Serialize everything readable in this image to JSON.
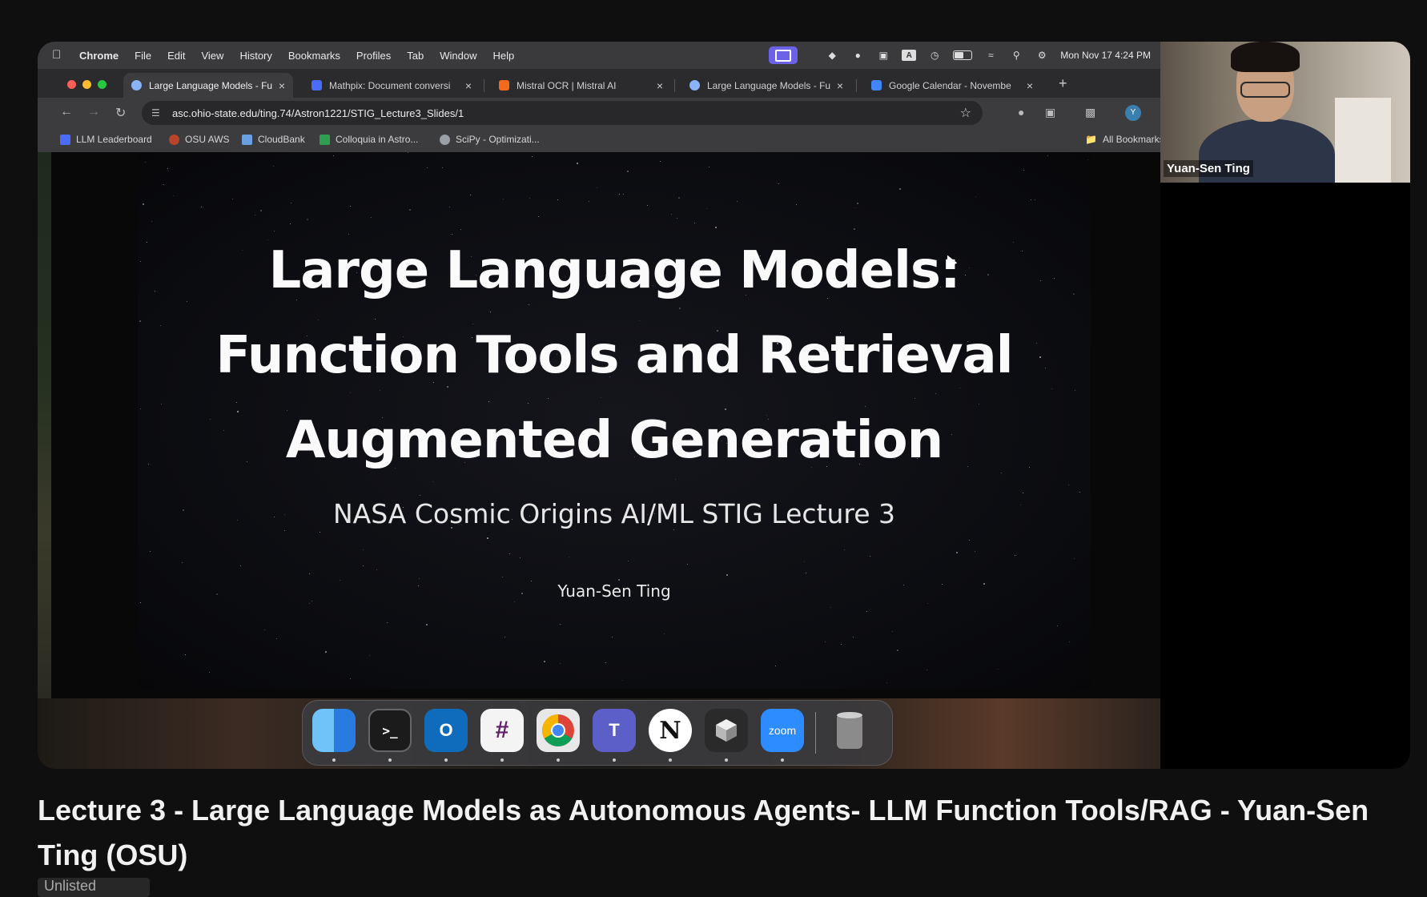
{
  "menubar": {
    "items": [
      "Chrome",
      "File",
      "Edit",
      "View",
      "History",
      "Bookmarks",
      "Profiles",
      "Tab",
      "Window",
      "Help"
    ],
    "datetime": "Mon Nov 17  4:24 PM"
  },
  "tabs": [
    {
      "title": "Large Language Models - Fu",
      "active": true,
      "favicon_color": "#8ab4f8"
    },
    {
      "title": "Mathpix: Document conversi",
      "active": false,
      "favicon_color": "#4a6cf7"
    },
    {
      "title": "Mistral OCR | Mistral AI",
      "active": false,
      "favicon_color": "#f26b1d"
    },
    {
      "title": "Large Language Models - Fu",
      "active": false,
      "favicon_color": "#8ab4f8"
    },
    {
      "title": "Google Calendar - Novembe",
      "active": false,
      "favicon_color": "#4285f4"
    }
  ],
  "omnibox": {
    "url": "asc.ohio-state.edu/ting.74/Astron1221/STIG_Lecture3_Slides/1"
  },
  "profile_initial": "Y",
  "bookmarks": [
    {
      "label": "LLM Leaderboard",
      "icon_color": "#4a6cf7"
    },
    {
      "label": "OSU AWS",
      "icon_color": "#b8442a"
    },
    {
      "label": "CloudBank",
      "icon_color": "#6aa0e0"
    },
    {
      "label": "Colloquia in Astro...",
      "icon_color": "#2f9e4f"
    },
    {
      "label": "SciPy - Optimizati...",
      "icon_color": "#9aa0a6"
    }
  ],
  "bookmarks_all": "All Bookmarks",
  "slide": {
    "title_lines": [
      "Large Language Models:",
      "Function Tools and Retrieval",
      "Augmented Generation"
    ],
    "subtitle": "NASA Cosmic Origins AI/ML STIG Lecture 3",
    "author": "Yuan-Sen Ting"
  },
  "dock": [
    {
      "name": "finder-icon",
      "label": "",
      "color": "#3a8ee6"
    },
    {
      "name": "terminal-icon",
      "label": ">_",
      "color": "#1b1b1b"
    },
    {
      "name": "outlook-icon",
      "label": "O",
      "color": "#0f6cbd"
    },
    {
      "name": "slack-icon",
      "label": "#",
      "color": "#f4f4f4"
    },
    {
      "name": "chrome-icon",
      "label": "",
      "color": "#e8e8e8"
    },
    {
      "name": "teams-icon",
      "label": "T",
      "color": "#5b5fc7"
    },
    {
      "name": "notion-icon",
      "label": "N",
      "color": "#ffffff"
    },
    {
      "name": "cube-app-icon",
      "label": "",
      "color": "#2a2a2a"
    },
    {
      "name": "zoom-icon",
      "label": "zoom",
      "color": "#2d8cff"
    }
  ],
  "webcam": {
    "name": "Yuan-Sen Ting"
  },
  "video": {
    "title": "Lecture 3 - Large Language Models as Autonomous Agents- LLM Function Tools/RAG - Yuan-Sen Ting (OSU)",
    "badge": "Unlisted"
  }
}
